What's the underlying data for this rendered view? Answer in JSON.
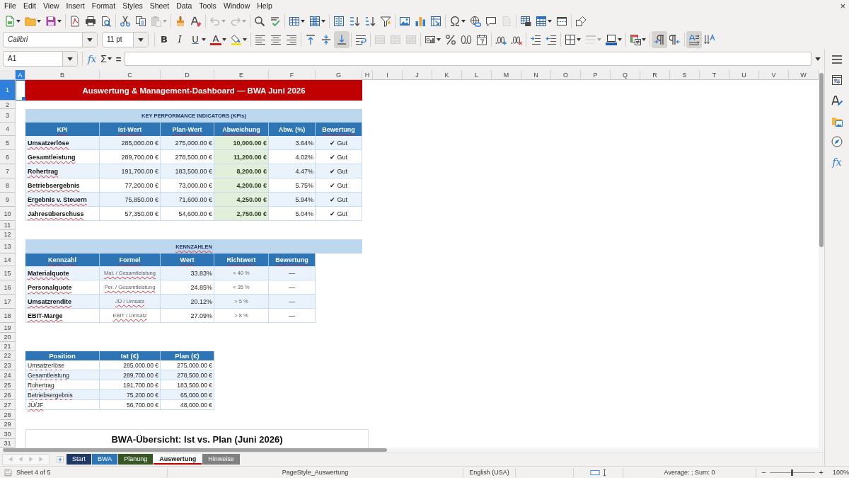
{
  "menu_bar": {
    "items": [
      "File",
      "Edit",
      "View",
      "Insert",
      "Format",
      "Styles",
      "Sheet",
      "Data",
      "Tools",
      "Window",
      "Help"
    ],
    "close": "×"
  },
  "standard_toolbar": [
    {
      "disabled": false
    },
    {
      "disabled": false
    },
    {
      "disabled": false
    },
    {
      "disabled": false
    },
    {
      "disabled": false
    },
    {
      "disabled": false
    },
    {
      "disabled": false
    },
    {
      "disabled": false
    },
    {
      "disabled": true
    },
    {
      "disabled": false
    },
    {
      "disabled": false
    },
    {
      "disabled": true
    },
    {
      "disabled": true
    },
    {
      "disabled": false
    },
    {
      "disabled": false
    },
    {
      "disabled": false
    },
    {
      "disabled": false
    },
    {
      "disabled": false
    },
    {
      "disabled": false
    },
    {
      "disabled": false
    },
    {
      "disabled": false
    },
    {
      "disabled": false
    },
    {
      "disabled": false
    },
    {
      "disabled": false
    },
    {
      "disabled": false
    },
    {
      "disabled": false
    },
    {
      "disabled": false
    },
    {
      "disabled": true
    },
    {
      "disabled": false
    },
    {
      "disabled": false
    },
    {
      "disabled": false
    },
    {
      "disabled": false
    }
  ],
  "formatting_toolbar": {
    "font_name": "Calibri",
    "font_size": "11 pt",
    "buttons": [
      {
        "glyph": "B",
        "pressed": false,
        "disabled": false
      },
      {
        "glyph": "I",
        "pressed": false,
        "disabled": false
      },
      {
        "glyph": "U",
        "pressed": false,
        "disabled": false
      },
      {
        "glyph": "A",
        "pressed": false,
        "disabled": false
      },
      {
        "pressed": false,
        "disabled": false
      },
      {
        "pressed": false,
        "disabled": false
      },
      {
        "pressed": false,
        "disabled": false
      },
      {
        "pressed": false,
        "disabled": false
      },
      {
        "pressed": false,
        "disabled": false
      },
      {
        "pressed": false,
        "disabled": false
      },
      {
        "pressed": true,
        "disabled": false
      },
      {
        "pressed": false,
        "disabled": false
      },
      {
        "pressed": false,
        "disabled": true
      },
      {
        "pressed": false,
        "disabled": true
      },
      {
        "pressed": false,
        "disabled": true
      },
      {
        "pressed": false,
        "disabled": false
      },
      {
        "pressed": false,
        "disabled": false
      },
      {
        "pressed": false,
        "disabled": false
      },
      {
        "pressed": false,
        "disabled": false
      },
      {
        "pressed": false,
        "disabled": false
      },
      {
        "pressed": false,
        "disabled": false
      },
      {
        "pressed": false,
        "disabled": false
      },
      {
        "pressed": false,
        "disabled": false
      },
      {
        "pressed": false,
        "disabled": false
      },
      {
        "pressed": false,
        "disabled": true
      },
      {
        "pressed": false,
        "disabled": false
      },
      {
        "pressed": false,
        "disabled": false
      },
      {
        "pressed": true,
        "disabled": false
      },
      {
        "pressed": false,
        "disabled": false
      },
      {
        "pressed": true,
        "disabled": false
      },
      {
        "pressed": false,
        "disabled": false
      }
    ]
  },
  "formula_bar": {
    "name_box": "A1",
    "function_wizard": "fx",
    "sum": "Σ",
    "formula": "="
  },
  "sheet": {
    "columns": [
      {
        "label": "A",
        "selected": true
      },
      {
        "label": "B",
        "selected": false
      },
      {
        "label": "C",
        "selected": false
      },
      {
        "label": "D",
        "selected": false
      },
      {
        "label": "E",
        "selected": false
      },
      {
        "label": "F",
        "selected": false
      },
      {
        "label": "G",
        "selected": false
      },
      {
        "label": "H",
        "selected": false
      },
      {
        "label": "I",
        "selected": false
      },
      {
        "label": "J",
        "selected": false
      },
      {
        "label": "K",
        "selected": false
      },
      {
        "label": "L",
        "selected": false
      },
      {
        "label": "M",
        "selected": false
      },
      {
        "label": "N",
        "selected": false
      },
      {
        "label": "O",
        "selected": false
      },
      {
        "label": "P",
        "selected": false
      },
      {
        "label": "Q",
        "selected": false
      },
      {
        "label": "R",
        "selected": false
      },
      {
        "label": "S",
        "selected": false
      },
      {
        "label": "T",
        "selected": false
      },
      {
        "label": "U",
        "selected": false
      },
      {
        "label": "V",
        "selected": false
      },
      {
        "label": "W",
        "selected": false
      }
    ],
    "rows": [
      {
        "label": "1",
        "selected": true
      },
      {
        "label": "2",
        "selected": false
      },
      {
        "label": "3",
        "selected": false
      },
      {
        "label": "4",
        "selected": false
      },
      {
        "label": "5",
        "selected": false
      },
      {
        "label": "6",
        "selected": false
      },
      {
        "label": "7",
        "selected": false
      },
      {
        "label": "8",
        "selected": false
      },
      {
        "label": "9",
        "selected": false
      },
      {
        "label": "10",
        "selected": false
      },
      {
        "label": "11",
        "selected": false
      },
      {
        "label": "12",
        "selected": false
      },
      {
        "label": "13",
        "selected": false
      },
      {
        "label": "14",
        "selected": false
      },
      {
        "label": "15",
        "selected": false
      },
      {
        "label": "16",
        "selected": false
      },
      {
        "label": "17",
        "selected": false
      },
      {
        "label": "18",
        "selected": false
      },
      {
        "label": "19",
        "selected": false
      },
      {
        "label": "20",
        "selected": false
      },
      {
        "label": "21",
        "selected": false
      },
      {
        "label": "22",
        "selected": false
      },
      {
        "label": "23",
        "selected": false
      },
      {
        "label": "24",
        "selected": false
      },
      {
        "label": "25",
        "selected": false
      },
      {
        "label": "26",
        "selected": false
      },
      {
        "label": "27",
        "selected": false
      },
      {
        "label": "28",
        "selected": false
      },
      {
        "label": "29",
        "selected": false
      },
      {
        "label": "30",
        "selected": false
      },
      {
        "label": "31",
        "selected": false
      }
    ],
    "title_banner": "Auswertung & Management-Dashboard — BWA Juni 2026",
    "kpi_table": {
      "title": {
        "text": "KEY PERFORMANCE INDICATORS (KPIs)",
        "misspelled": false
      },
      "header": {
        "cells": [
          "KPI",
          "Ist-Wert",
          "Plan-Wert",
          "Abweichung",
          "Abw. (%)",
          "Bewertung"
        ],
        "misspelled": [
          true,
          true,
          true,
          true,
          false,
          true
        ]
      },
      "rows": [
        {
          "cells": [
            "Umsatzerlöse",
            "285,000.00 €",
            "275,000.00 €",
            "10,000.00 €",
            "3.64%",
            "✔ Gut"
          ],
          "misspelled": [
            true,
            false,
            false,
            false,
            false,
            false
          ]
        },
        {
          "cells": [
            "Gesamtleistung",
            "289,700.00 €",
            "278,500.00 €",
            "11,200.00 €",
            "4.02%",
            "✔ Gut"
          ],
          "misspelled": [
            true,
            false,
            false,
            false,
            false,
            false
          ]
        },
        {
          "cells": [
            "Rohertrag",
            "191,700.00 €",
            "183,500.00 €",
            "8,200.00 €",
            "4.47%",
            "✔ Gut"
          ],
          "misspelled": [
            true,
            false,
            false,
            false,
            false,
            false
          ]
        },
        {
          "cells": [
            "Betriebsergebnis",
            "77,200.00 €",
            "73,000.00 €",
            "4,200.00 €",
            "5.75%",
            "✔ Gut"
          ],
          "misspelled": [
            true,
            false,
            false,
            false,
            false,
            false
          ]
        },
        {
          "cells": [
            "Ergebnis v. Steuern",
            "75,850.00 €",
            "71,600.00 €",
            "4,250.00 €",
            "5.94%",
            "✔ Gut"
          ],
          "misspelled": [
            true,
            false,
            false,
            false,
            false,
            false
          ]
        },
        {
          "cells": [
            "Jahresüberschuss",
            "57,350.00 €",
            "54,600.00 €",
            "2,750.00 €",
            "5.04%",
            "✔ Gut"
          ],
          "misspelled": [
            true,
            false,
            false,
            false,
            false,
            false
          ]
        }
      ]
    },
    "kennzahlen_table": {
      "title": {
        "text": "KENNZAHLEN",
        "misspelled": true
      },
      "header": {
        "cells": [
          "Kennzahl",
          "Formel",
          "Wert",
          "Richtwert",
          "Bewertung"
        ],
        "misspelled": [
          true,
          true,
          true,
          true,
          true
        ]
      },
      "rows": [
        {
          "cells": [
            "Materialquote",
            "Mat. / Gesamtleistung",
            "33.83%",
            "< 40 %",
            "—"
          ],
          "misspelled": [
            true,
            true,
            false,
            false,
            false
          ]
        },
        {
          "cells": [
            "Personalquote",
            "Per. / Gesamtleistung",
            "24.85%",
            "< 35 %",
            "—"
          ],
          "misspelled": [
            true,
            true,
            false,
            false,
            false
          ]
        },
        {
          "cells": [
            "Umsatzrendite",
            "JÜ / Umsatz",
            "20.12%",
            "> 5 %",
            "—"
          ],
          "misspelled": [
            true,
            true,
            false,
            false,
            false
          ]
        },
        {
          "cells": [
            "EBIT-Marge",
            "EBIT / Umsatz",
            "27.09%",
            "> 8 %",
            "—"
          ],
          "misspelled": [
            true,
            true,
            false,
            false,
            false
          ]
        }
      ]
    },
    "position_table": {
      "header": {
        "cells": [
          "Position",
          "Ist (€)",
          "Plan (€)"
        ],
        "misspelled": [
          false,
          true,
          false
        ]
      },
      "rows": [
        {
          "cells": [
            "Umsatzerlöse",
            "285,000.00 €",
            "275,000.00 €"
          ],
          "misspelled": [
            true,
            false,
            false
          ]
        },
        {
          "cells": [
            "Gesamtleistung",
            "289,700.00 €",
            "278,500.00 €"
          ],
          "misspelled": [
            true,
            false,
            false
          ]
        },
        {
          "cells": [
            "Rohertrag",
            "191,700.00 €",
            "183,500.00 €"
          ],
          "misspelled": [
            true,
            false,
            false
          ]
        },
        {
          "cells": [
            "Betriebsergebnis",
            "75,200.00 €",
            "65,000.00 €"
          ],
          "misspelled": [
            true,
            false,
            false
          ]
        },
        {
          "cells": [
            "JÜ/JF",
            "56,700.00 €",
            "48,000.00 €"
          ],
          "misspelled": [
            true,
            false,
            false
          ]
        }
      ]
    },
    "chart": {
      "title": "BWA-Übersicht: Ist vs. Plan (Juni 2026)"
    }
  },
  "sheet_tabs": [
    {
      "label": "Start",
      "color": "#1f3864",
      "selected": false
    },
    {
      "label": "BWA",
      "color": "#2e75b6",
      "selected": false
    },
    {
      "label": "Planung",
      "color": "#375623",
      "selected": false
    },
    {
      "label": "Auswertung",
      "color": "#c00000",
      "selected": true
    },
    {
      "label": "Hinweise",
      "color": "#808080",
      "selected": false
    }
  ],
  "sidebar": {
    "functions": "fx"
  },
  "status_bar": {
    "sheet_position": "Sheet 4 of 5",
    "page_style": "PageStyle_Auswertung",
    "language": "English (USA)",
    "summary": "Average: ; Sum: 0",
    "zoom_out": "−",
    "zoom_slider": {
      "level": 0.5
    },
    "zoom_in": "+",
    "zoom": "100%"
  }
}
